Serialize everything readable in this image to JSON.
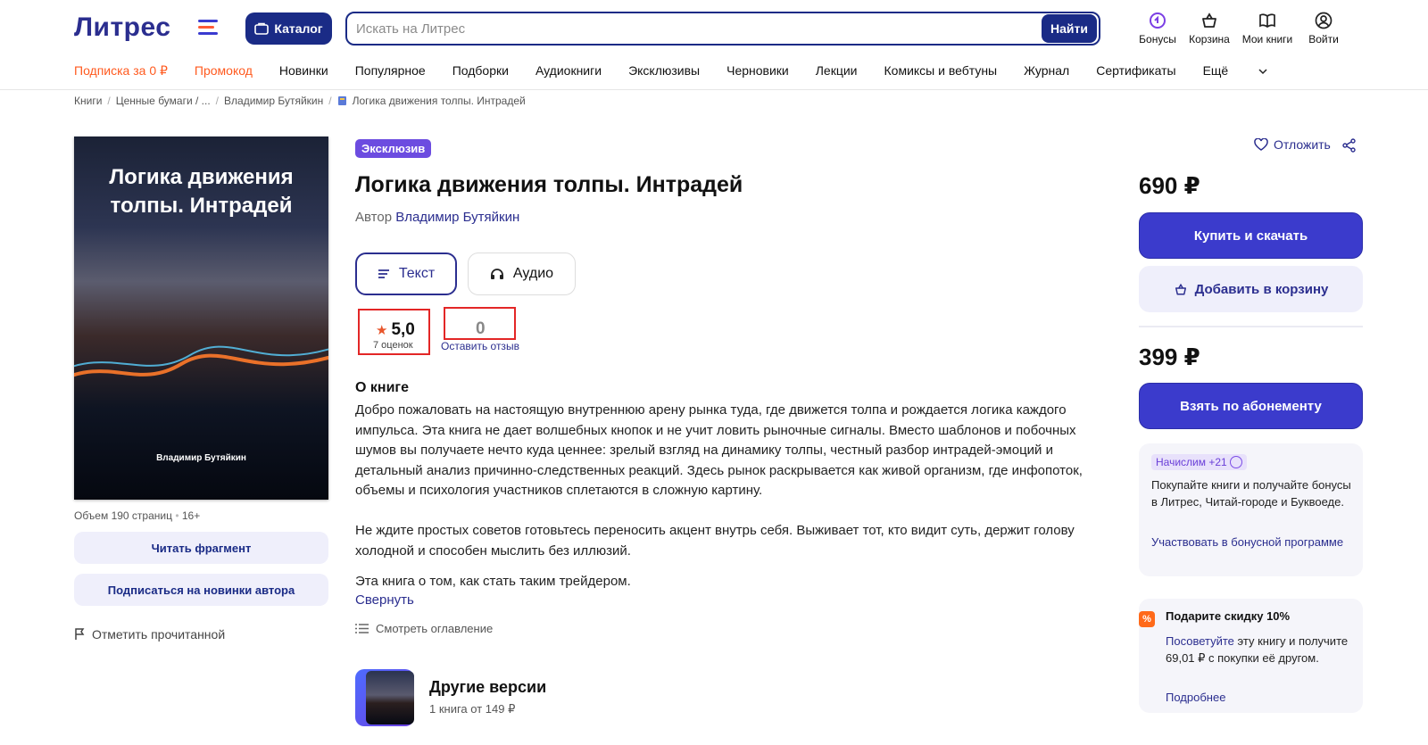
{
  "header": {
    "logo": "Литрес",
    "catalog_label": "Каталог",
    "search_placeholder": "Искать на Литрес",
    "search_button": "Найти",
    "icons": [
      {
        "name": "bonus-icon",
        "label": "Бонусы"
      },
      {
        "name": "cart-icon",
        "label": "Корзина"
      },
      {
        "name": "my-books-icon",
        "label": "Мои книги"
      },
      {
        "name": "user-icon",
        "label": "Войти"
      }
    ]
  },
  "nav": {
    "items": [
      "Подписка за 0 ₽",
      "Промокод",
      "Новинки",
      "Популярное",
      "Подборки",
      "Аудиокниги",
      "Эксклюзивы",
      "Черновики",
      "Лекции",
      "Комиксы и вебтуны",
      "Журнал",
      "Сертификаты",
      "Ещё"
    ]
  },
  "breadcrumb": [
    "Книги",
    "Ценные бумаги / ...",
    "Владимир Бутяйкин",
    "Логика движения толпы. Интрадей"
  ],
  "cover": {
    "title": "Логика движения толпы. Интрадей",
    "author": "Владимир Бутяйкин"
  },
  "left": {
    "meta": "Объем 190 страниц",
    "age": "16+",
    "read_fragment": "Читать фрагмент",
    "subscribe_author": "Подписаться на новинки автора",
    "mark_read": "Отметить прочитанной"
  },
  "book": {
    "badge": "Эксклюзив",
    "title": "Логика движения толпы. Интрадей",
    "author_prefix": "Автор",
    "author": "Владимир Бутяйкин",
    "formats": [
      "Текст",
      "Аудио"
    ],
    "rating": "5,0",
    "rating_count": "7 оценок",
    "reviews": "0",
    "leave_review": "Оставить отзыв",
    "about_heading": "О книге",
    "paragraphs": [
      "Добро пожаловать на настоящую внутреннюю арену рынка туда, где движется толпа и рождается логика каждого импульса. Эта книга не дает волшебных кнопок и не учит ловить рыночные сигналы. Вместо шаблонов и побочных шумов вы получаете нечто куда ценнее: зрелый взгляд на динамику толпы, честный разбор интрадей-эмоций и детальный анализ причинно-следственных реакций. Здесь рынок раскрывается как живой организм, где инфопоток, объемы и психология участников сплетаются в сложную картину.",
      "Не ждите простых советов готовьтесь переносить акцент внутрь себя. Выживает тот, кто видит суть, держит голову холодной и способен мыслить без иллюзий.",
      "Эта книга о том, как стать таким трейдером."
    ],
    "collapse": "Свернуть",
    "toc": "Смотреть оглавление",
    "other_versions_title": "Другие версии",
    "other_versions_sub": "1 книга от 149 ₽"
  },
  "purchase": {
    "postpone": "Отложить",
    "price": "690 ₽",
    "buy": "Купить и скачать",
    "add_to_cart": "Добавить в корзину",
    "sub_price": "399 ₽",
    "subscribe": "Взять по абонементу"
  },
  "bonus_card": {
    "badge": "Начислим +21",
    "text": "Покупайте книги и получайте бонусы в Литрес, Читай-городе и Буквоеде.",
    "link": "Участвовать в бонусной программе"
  },
  "gift_card": {
    "icon": "%",
    "title": "Подарите скидку 10%",
    "link": "Посоветуйте",
    "text": "эту книгу и получите 69,01 ₽ с покупки её другом.",
    "more": "Подробнее"
  },
  "colors": {
    "brand": "#1a2b86",
    "accent": "#3b3bcc",
    "promo": "#ff5a1f",
    "highlight_box": "#e32626"
  }
}
